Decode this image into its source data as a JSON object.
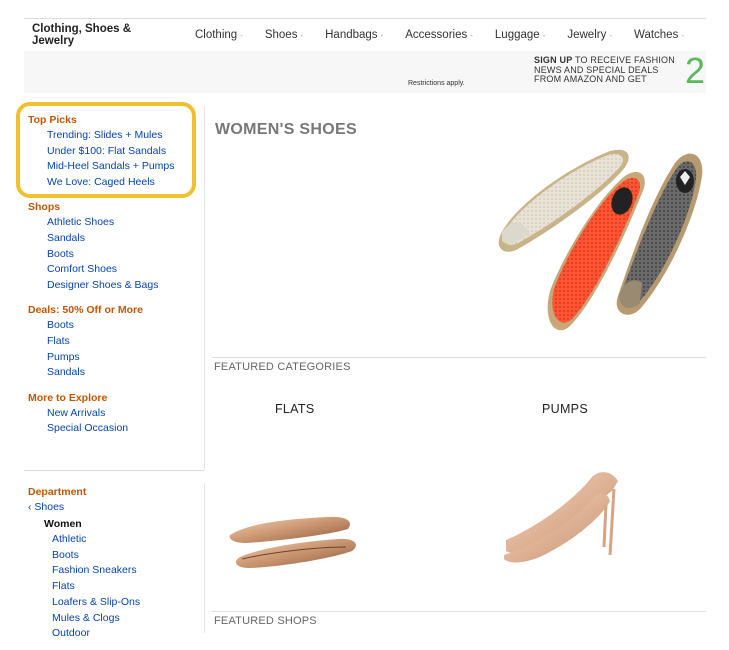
{
  "topnav": {
    "brand": "Clothing, Shoes & Jewelry",
    "items": [
      {
        "label": "Clothing"
      },
      {
        "label": "Shoes"
      },
      {
        "label": "Handbags"
      },
      {
        "label": "Accessories"
      },
      {
        "label": "Luggage"
      },
      {
        "label": "Jewelry"
      },
      {
        "label": "Watches"
      }
    ],
    "caret": "-"
  },
  "banner": {
    "restrictions": "Restrictions apply.",
    "signup_bold": "SIGN UP",
    "signup_line1": " TO RECEIVE FASHION",
    "signup_line2": "NEWS AND SPECIAL DEALS",
    "signup_line3": "FROM AMAZON AND GET",
    "big_number": "2"
  },
  "sidebar": {
    "top_picks": {
      "title": "Top Picks",
      "links": [
        "Trending: Slides + Mules",
        "Under $100: Flat Sandals",
        "Mid-Heel Sandals + Pumps",
        "We Love: Caged Heels"
      ]
    },
    "shops": {
      "title": "Shops",
      "links": [
        "Athletic Shoes",
        "Sandals",
        "Boots",
        "Comfort Shoes",
        "Designer Shoes & Bags"
      ]
    },
    "deals": {
      "title": "Deals: 50% Off or More",
      "links": [
        "Boots",
        "Flats",
        "Pumps",
        "Sandals"
      ]
    },
    "explore": {
      "title": "More to Explore",
      "links": [
        "New Arrivals",
        "Special Occasion"
      ]
    }
  },
  "department": {
    "title": "Department",
    "back": "‹ Shoes",
    "current": "Women",
    "subs": [
      "Athletic",
      "Boots",
      "Fashion Sneakers",
      "Flats",
      "Loafers & Slip-Ons",
      "Mules & Clogs",
      "Outdoor"
    ]
  },
  "main": {
    "title": "WOMEN'S SHOES",
    "featured_categories": "FEATURED CATEGORIES",
    "categories": [
      {
        "label": "FLATS"
      },
      {
        "label": "PUMPS"
      }
    ],
    "featured_shops": "FEATURED SHOPS"
  },
  "colors": {
    "accent_orange": "#c45500",
    "link_blue": "#0645ad",
    "highlight_yellow": "#f0c030",
    "promo_green": "#5cb85c"
  }
}
